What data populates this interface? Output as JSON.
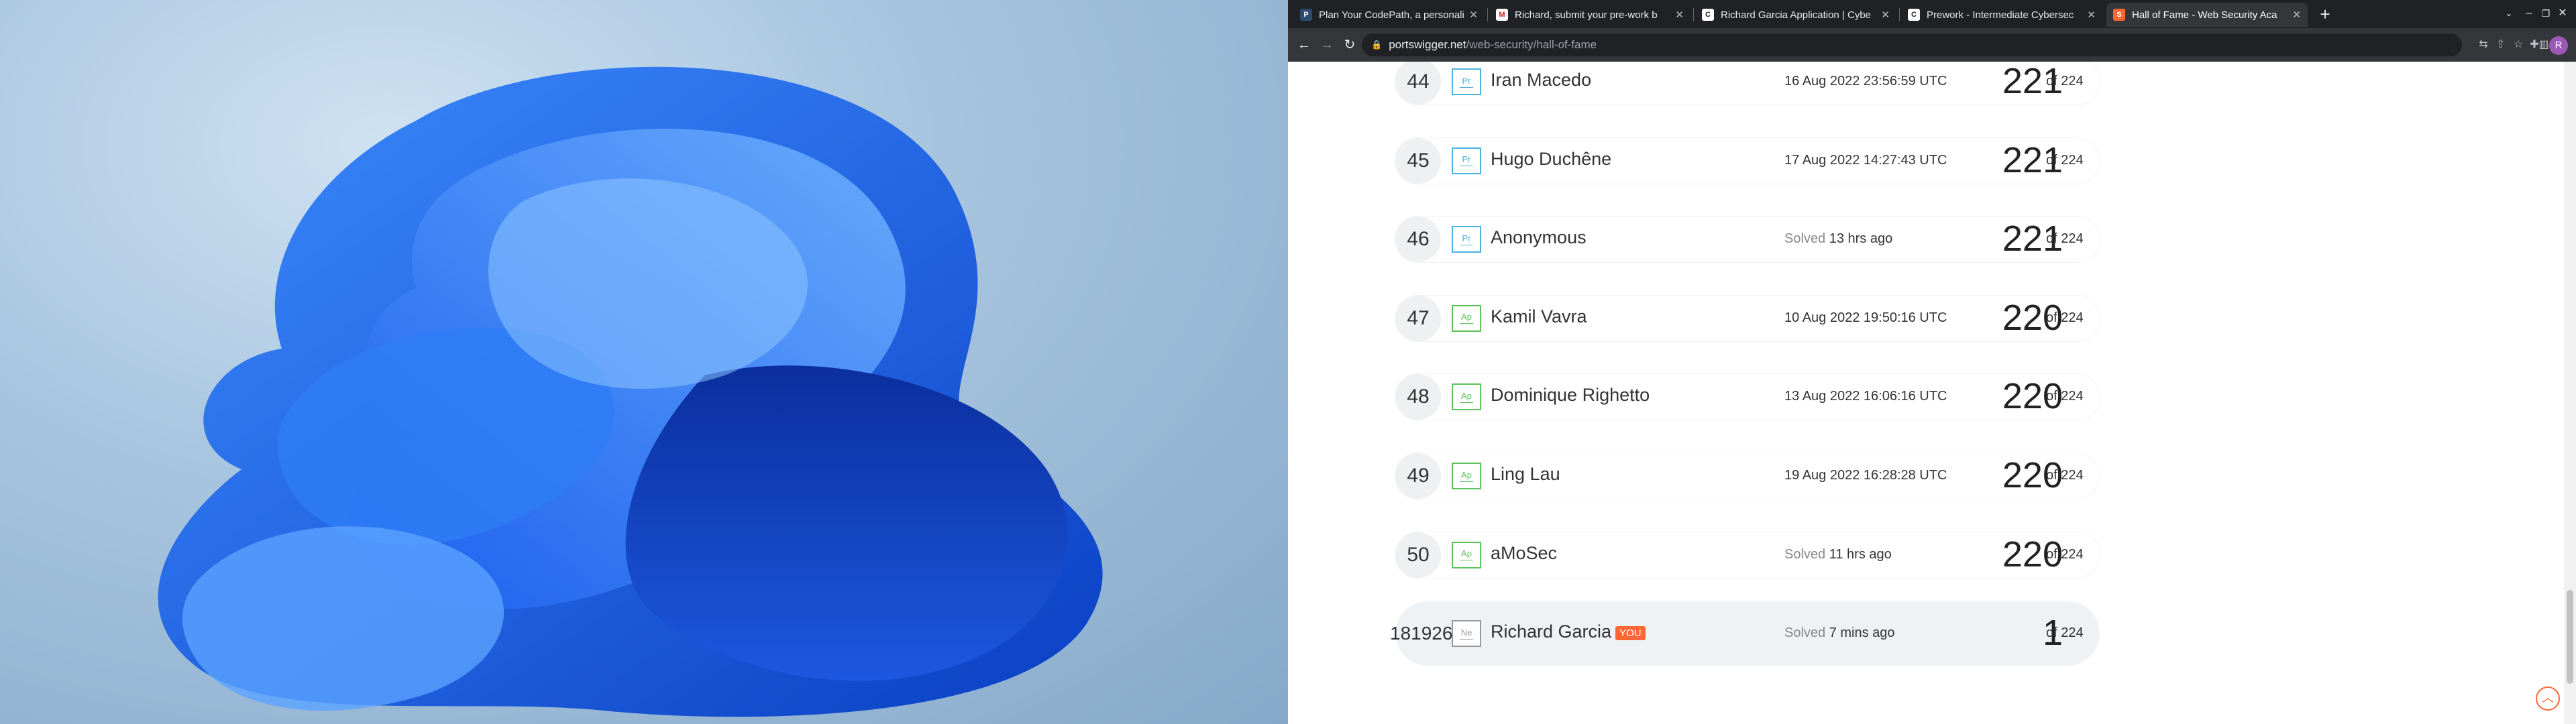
{
  "browser": {
    "tabs": [
      {
        "title": "Plan Your CodePath, a personaliz",
        "favicon": "P",
        "favicon_color": "#2b4b6f"
      },
      {
        "title": "Richard, submit your pre-work b",
        "favicon": "M",
        "favicon_color": "#c5221f"
      },
      {
        "title": "Richard Garcia Application | Cybe",
        "favicon": "C",
        "favicon_color": "#ffffff"
      },
      {
        "title": "Prework - Intermediate Cybersec",
        "favicon": "C",
        "favicon_color": "#ffffff"
      },
      {
        "title": "Hall of Fame - Web Security Aca",
        "favicon": "S",
        "favicon_color": "#ff6633",
        "active": true
      }
    ],
    "new_tab_label": "+",
    "url_host": "portswigger.net",
    "url_path": "/web-security/hall-of-fame",
    "profile_initial": "R"
  },
  "hall_of_fame": {
    "of_label": "of 224",
    "you_label": "YOU",
    "rows": [
      {
        "rank": "44",
        "badge": "Pr",
        "badge_color": "#4ab3e2",
        "name": "Iran Macedo",
        "solved_prefix": "",
        "solved": "16 Aug 2022 23:56:59 UTC",
        "score": "221"
      },
      {
        "rank": "45",
        "badge": "Pr",
        "badge_color": "#4ab3e2",
        "name": "Hugo Duchêne",
        "solved_prefix": "",
        "solved": "17 Aug 2022 14:27:43 UTC",
        "score": "221"
      },
      {
        "rank": "46",
        "badge": "Pr",
        "badge_color": "#4ab3e2",
        "name": "Anonymous",
        "solved_prefix": "Solved",
        "solved": "13 hrs ago",
        "score": "221"
      },
      {
        "rank": "47",
        "badge": "Ap",
        "badge_color": "#5cc35c",
        "name": "Kamil Vavra",
        "solved_prefix": "",
        "solved": "10 Aug 2022 19:50:16 UTC",
        "score": "220"
      },
      {
        "rank": "48",
        "badge": "Ap",
        "badge_color": "#5cc35c",
        "name": "Dominique Righetto",
        "solved_prefix": "",
        "solved": "13 Aug 2022 16:06:16 UTC",
        "score": "220"
      },
      {
        "rank": "49",
        "badge": "Ap",
        "badge_color": "#5cc35c",
        "name": "Ling Lau",
        "solved_prefix": "",
        "solved": "19 Aug 2022 16:28:28 UTC",
        "score": "220"
      },
      {
        "rank": "50",
        "badge": "Ap",
        "badge_color": "#5cc35c",
        "name": "aMoSec",
        "solved_prefix": "Solved",
        "solved": "11 hrs ago",
        "score": "220"
      }
    ],
    "you_row": {
      "rank": "181926",
      "badge": "Ne",
      "badge_color": "#999999",
      "name": "Richard Garcia",
      "solved_prefix": "Solved",
      "solved": "7 mins ago",
      "score": "1"
    }
  },
  "colors": {
    "accent": "#ff6633",
    "tab_bar": "#202124",
    "toolbar": "#35363a"
  }
}
